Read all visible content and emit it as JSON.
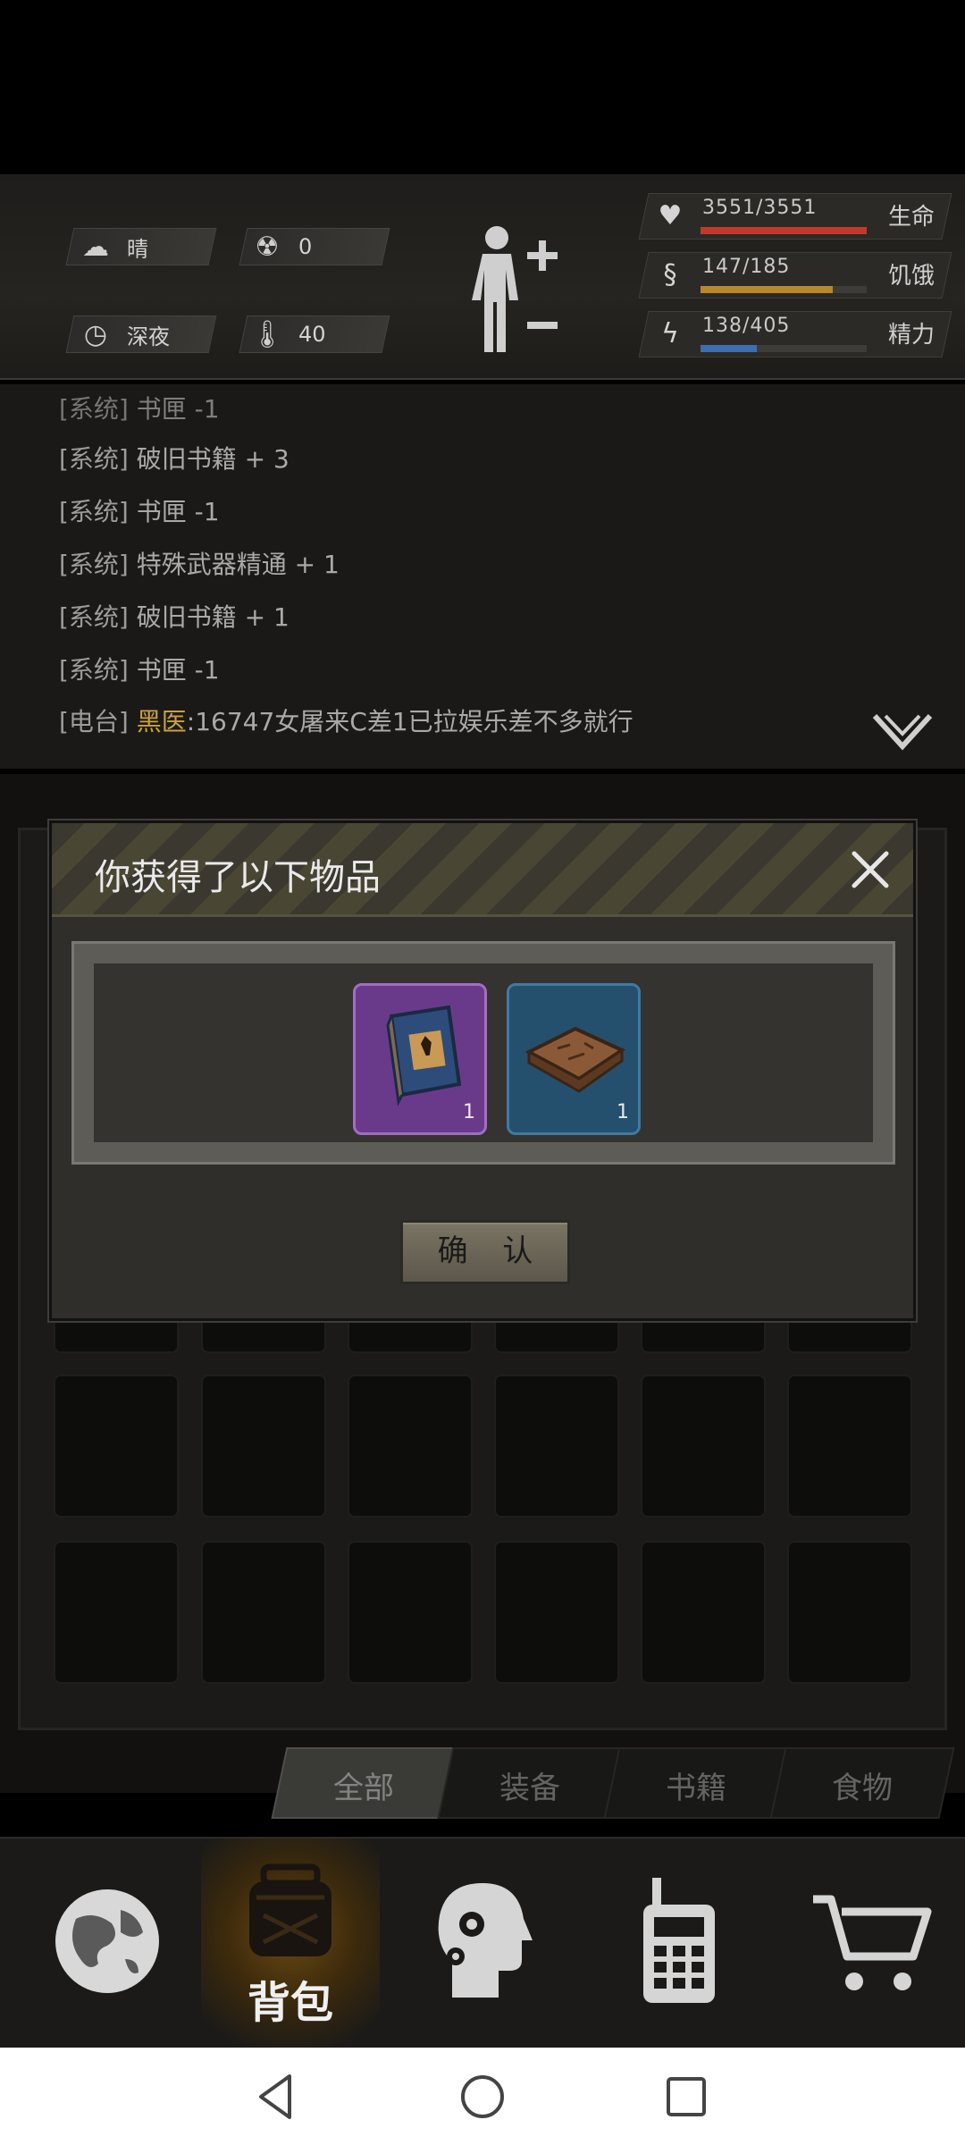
{
  "status": {
    "weather": {
      "icon": "cloud-sun-icon",
      "value": "晴"
    },
    "radiation": {
      "icon": "radiation-icon",
      "value": "0"
    },
    "time_of_day": {
      "icon": "clock-icon",
      "value": "深夜"
    },
    "temperature": {
      "icon": "thermometer-icon",
      "value": "40"
    },
    "stats": [
      {
        "id": "health",
        "icon": "heart-icon",
        "value": "3551/3551",
        "label": "生命",
        "color": "#c0392b",
        "level": 1.0
      },
      {
        "id": "hunger",
        "icon": "stomach-icon",
        "value": "147/185",
        "label": "饥饿",
        "color": "#b8892a",
        "level": 0.795
      },
      {
        "id": "stamina",
        "icon": "lightning-head-icon",
        "value": "138/405",
        "label": "精力",
        "color": "#3b6fb0",
        "level": 0.341
      }
    ]
  },
  "log": {
    "lines": [
      {
        "tag": "[系统]",
        "text": " 书匣 -1"
      },
      {
        "tag": "[系统]",
        "text": " 破旧书籍 + 3"
      },
      {
        "tag": "[系统]",
        "text": " 书匣 -1"
      },
      {
        "tag": "[系统]",
        "text": " 特殊武器精通 + 1"
      },
      {
        "tag": "[系统]",
        "text": " 破旧书籍 + 1"
      },
      {
        "tag": "[系统]",
        "text": " 书匣 -1"
      }
    ],
    "radio": {
      "tag": "[电台]",
      "speaker": " 黑医",
      "text": ":16747女屠来C差1已拉娱乐差不多就行"
    }
  },
  "dialog": {
    "title": "你获得了以下物品",
    "confirm_label": "确 认",
    "items": [
      {
        "icon": "skill-book-icon",
        "qty": "1",
        "rarity_color": "#6a3a8a"
      },
      {
        "icon": "old-book-icon",
        "qty": "1",
        "rarity_color": "#24506e"
      }
    ]
  },
  "filters": {
    "all": "全部",
    "equipment": "装备",
    "books": "书籍",
    "food": "食物"
  },
  "nav": {
    "world": {
      "icon": "globe-icon"
    },
    "backpack": {
      "icon": "backpack-icon",
      "label": "背包"
    },
    "skills": {
      "icon": "brain-gears-icon"
    },
    "radio": {
      "icon": "walkie-talkie-icon"
    },
    "shop": {
      "icon": "cart-icon"
    }
  }
}
